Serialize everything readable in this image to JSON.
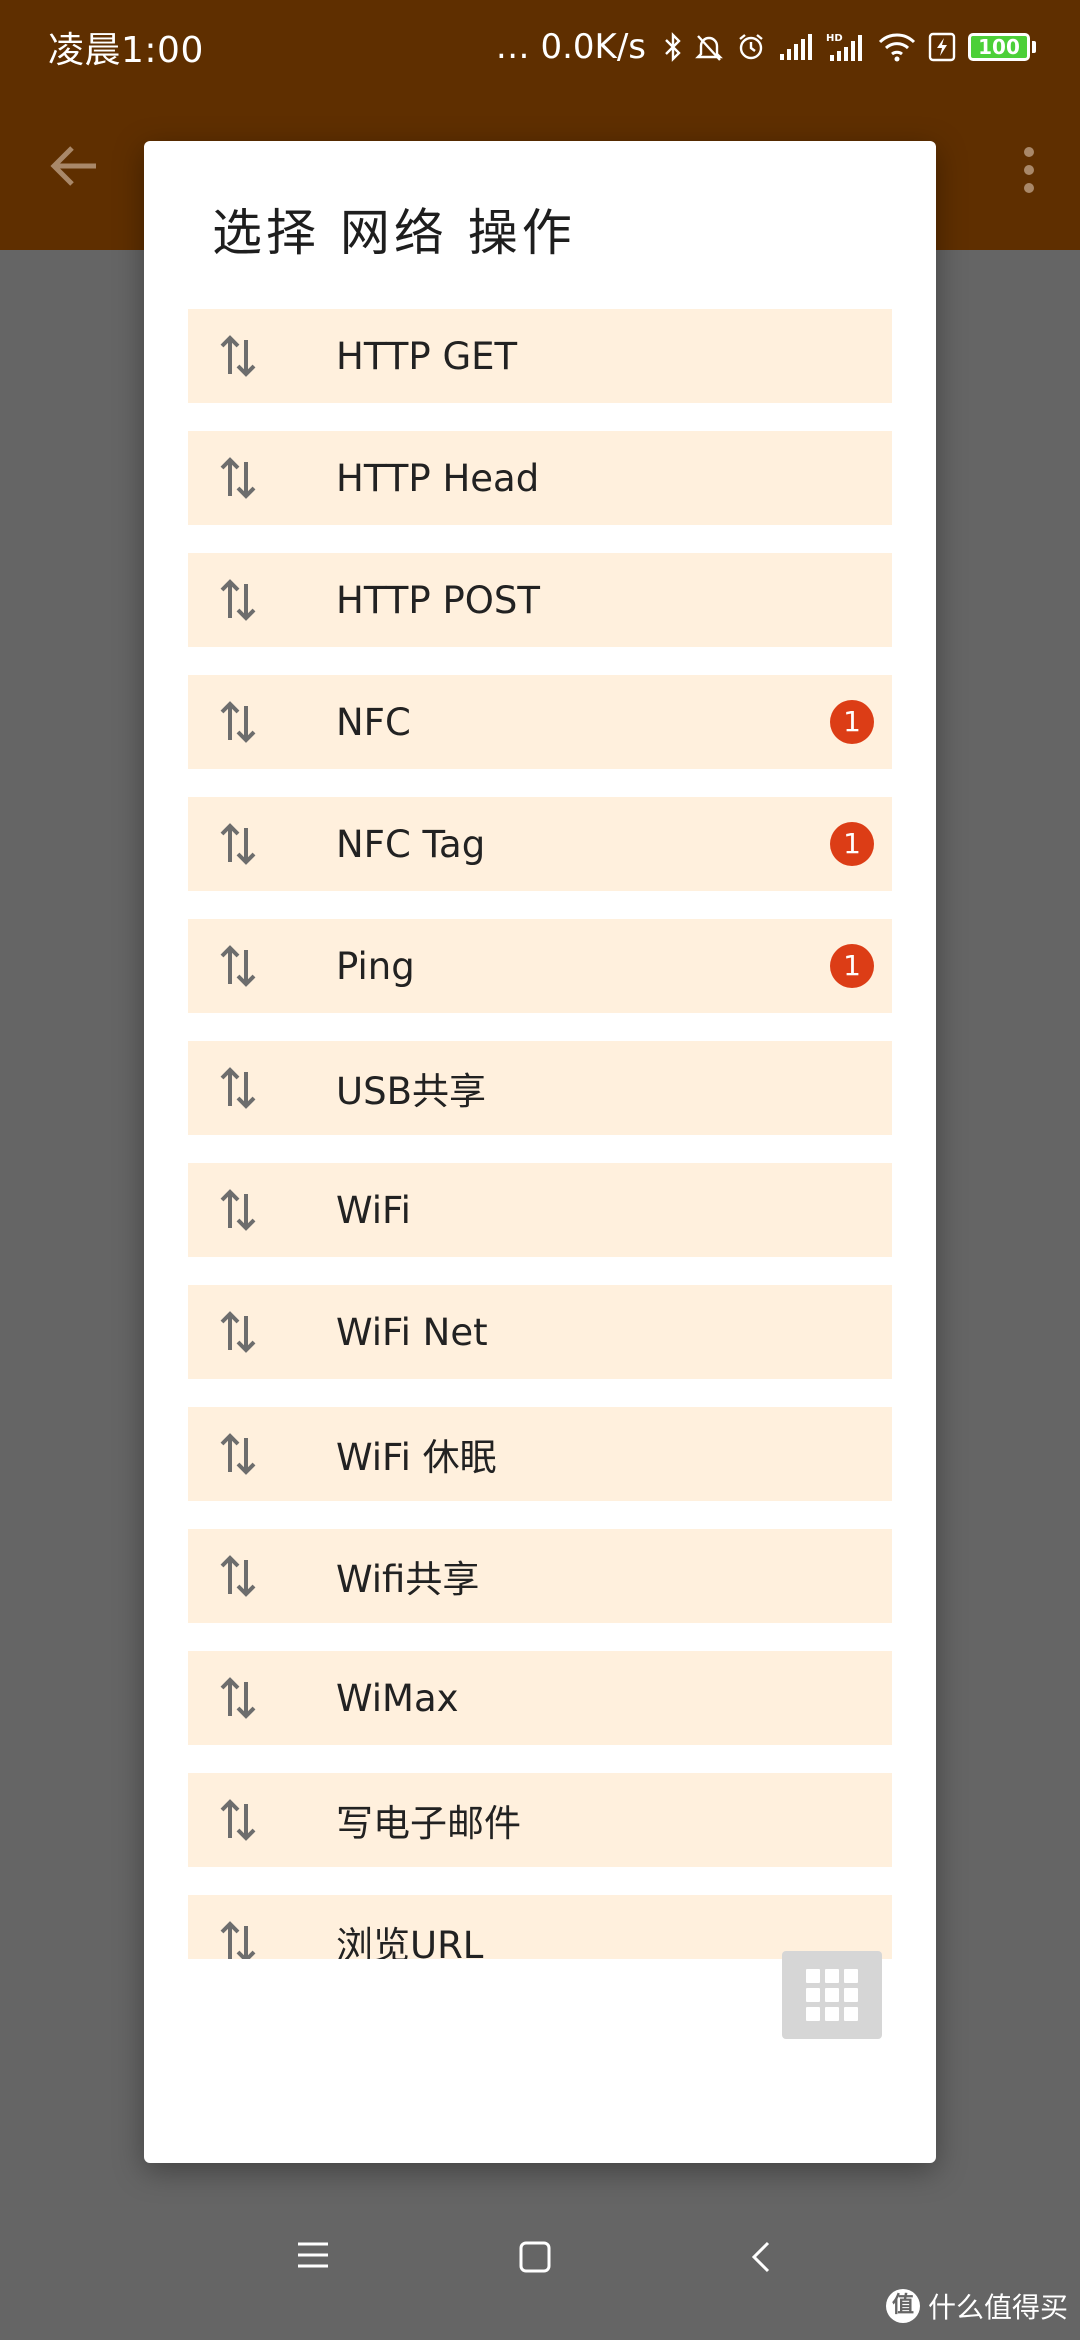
{
  "status_bar": {
    "time": "凌晨1:00",
    "speed": "… 0.0K/s",
    "battery": "100",
    "icons": [
      "bluetooth-icon",
      "silent-icon",
      "alarm-icon",
      "signal-icon",
      "hd-signal-icon",
      "wifi-icon",
      "charging-icon",
      "battery-icon"
    ]
  },
  "app_bar": {
    "icons": [
      "back-arrow-icon",
      "overflow-menu-icon"
    ]
  },
  "dialog": {
    "title": "选择 网络 操作",
    "items": [
      {
        "label": "HTTP GET",
        "icon": "network-arrows-icon",
        "badge": ""
      },
      {
        "label": "HTTP Head",
        "icon": "network-arrows-icon",
        "badge": ""
      },
      {
        "label": "HTTP POST",
        "icon": "network-arrows-icon",
        "badge": ""
      },
      {
        "label": "NFC",
        "icon": "network-arrows-icon",
        "badge": "1"
      },
      {
        "label": "NFC Tag",
        "icon": "network-arrows-icon",
        "badge": "1"
      },
      {
        "label": "Ping",
        "icon": "network-arrows-icon",
        "badge": "1"
      },
      {
        "label": "USB共享",
        "icon": "network-arrows-icon",
        "badge": ""
      },
      {
        "label": "WiFi",
        "icon": "network-arrows-icon",
        "badge": ""
      },
      {
        "label": "WiFi Net",
        "icon": "network-arrows-icon",
        "badge": ""
      },
      {
        "label": "WiFi 休眠",
        "icon": "network-arrows-icon",
        "badge": ""
      },
      {
        "label": "Wifi共享",
        "icon": "network-arrows-icon",
        "badge": ""
      },
      {
        "label": "WiMax",
        "icon": "network-arrows-icon",
        "badge": ""
      },
      {
        "label": "写电子邮件",
        "icon": "network-arrows-icon",
        "badge": ""
      },
      {
        "label": "浏览URL",
        "icon": "network-arrows-icon",
        "badge": ""
      }
    ],
    "grid_button_icon": "grid-icon"
  },
  "nav_bar": {
    "icons": [
      "menu-icon",
      "home-icon",
      "back-icon"
    ]
  },
  "watermark": {
    "logo": "值",
    "text": "什么值得买"
  },
  "colors": {
    "status_bar": "#5f2f00",
    "item_background": "#fff0dd",
    "badge": "#dc3d16",
    "dim_overlay": "#656565"
  }
}
